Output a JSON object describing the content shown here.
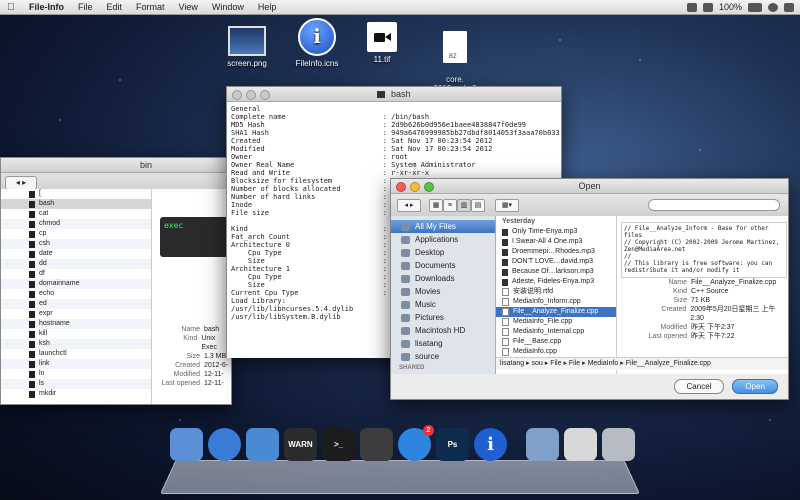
{
  "menubar": {
    "app": "File-Info",
    "items": [
      "File",
      "Edit",
      "Format",
      "View",
      "Window",
      "Help"
    ],
    "battery": "100%",
    "icons": [
      "apple-icon",
      "wifi-icon",
      "volume-icon",
      "battery-icon",
      "search-icon",
      "list-icon"
    ]
  },
  "desktop": {
    "icons": [
      {
        "label": "screen.png",
        "icon": "screenshot-icon"
      },
      {
        "label": "FileInfo.icns",
        "icon": "info-icon"
      },
      {
        "label": "11.tif",
        "icon": "video-icon"
      },
      {
        "label": "core.\n2013…r.bz2",
        "icon": "archive-icon",
        "badge": "BZ"
      }
    ]
  },
  "terminal": {
    "title": "bash",
    "section1": "General",
    "rows": [
      [
        "Complete name",
        ": /bin/bash"
      ],
      [
        "MD5 Hash",
        ": 2d9b626b0d956e1baee4838847f0de99"
      ],
      [
        "SHA1 Hash",
        ": 949a6476999985bb27dbdf8014053f3aaa70b033"
      ],
      [
        "Created",
        ": Sat Nov 17 00:23:54 2012"
      ],
      [
        "Modified",
        ": Sat Nov 17 00:23:54 2012"
      ],
      [
        "Owner",
        ": root"
      ],
      [
        "Owner Real Name",
        ": System Administrator"
      ],
      [
        "Read and Write",
        ": r-xr-xr-x"
      ],
      [
        "Blocksize for filesystem",
        ": 4096"
      ],
      [
        "Number of blocks allocated",
        ": 1264"
      ],
      [
        "Number of hard links",
        ": 1"
      ],
      [
        "Inode",
        ": 9161"
      ],
      [
        "File size",
        ": 1.27 MiB"
      ]
    ],
    "rows2": [
      [
        "Kind",
        ": Unix Exec"
      ],
      [
        "Fat_arch Count",
        ": 2"
      ],
      [
        "Architecture 0",
        ": Intel i38"
      ],
      [
        "    Cpu Type",
        ": Intel i38"
      ],
      [
        "    Size",
        ": 630448"
      ],
      [
        "Architecture 1",
        ": Intel X86"
      ],
      [
        "    Cpu Type",
        ": Intel X86"
      ],
      [
        "    Size",
        ": 699040"
      ],
      [
        "Current Cpu Type",
        ": Intel i38"
      ],
      [
        "Load Library:",
        ""
      ]
    ],
    "libs": [
      "/usr/lib/libncurses.5.4.dylib",
      "/usr/lib/libSystem.B.dylib"
    ]
  },
  "finder": {
    "title": "bin",
    "files": [
      "[",
      "bash",
      "cat",
      "chmod",
      "cp",
      "csh",
      "date",
      "dd",
      "df",
      "domainname",
      "echo",
      "ed",
      "expr",
      "hostname",
      "kill",
      "ksh",
      "launchctl",
      "link",
      "ln",
      "ls",
      "mkdir"
    ],
    "selected": "bash",
    "preview_label": "exec",
    "meta": [
      [
        "Name",
        "bash"
      ],
      [
        "Kind",
        "Unix Exec"
      ],
      [
        "Size",
        "1.3 MB"
      ],
      [
        "Created",
        "2012-6-"
      ],
      [
        "Modified",
        "12-11-"
      ],
      [
        "Last opened",
        "12-11-"
      ]
    ]
  },
  "open_dialog": {
    "title": "Open",
    "sidebar": [
      "All My Files",
      "Applications",
      "Desktop",
      "Documents",
      "Downloads",
      "Movies",
      "Music",
      "Pictures",
      "Macintosh HD",
      "lisatang",
      "source"
    ],
    "shared_label": "SHARED",
    "col_header": "Yesterday",
    "files": [
      "Only Time-Enya.mp3",
      "I Swear-All 4 One.mp3",
      "Droemmepi…Rhodes.mp3",
      "DON'T LOVE…david.mp3",
      "Because Of…larkson.mp3",
      "Adeste, Fideles-Enya.mp3",
      "安装说明.rtfd",
      "MediaInfo_Inform.cpp",
      "File__Analyze_Finalize.cpp",
      "MediaInfo_File.cpp",
      "MediaInfo_Internal.cpp",
      "File__Base.cpp",
      "MediaInfo.cpp",
      "File_Unknown.cpp"
    ],
    "selected": "File__Analyze_Finalize.cpp",
    "preview_text": "// File__Analyze_Inform - Base for other files\n// Copyright (C) 2002-2009 Jerome Martinez, Zen@MediaArea.net\n//\n// This library is free software: you can redistribute it and/or modify it",
    "meta": [
      [
        "Name",
        "File__Analyze_Finalize.cpp"
      ],
      [
        "Kind",
        "C++ Source"
      ],
      [
        "Size",
        "71 KB"
      ],
      [
        "Created",
        "2009年5月20日星期三 上午2:30"
      ],
      [
        "Modified",
        "昨天 下午2:37"
      ],
      [
        "Last opened",
        "昨天 下午7:22"
      ]
    ],
    "path": "lisatang ▸ sou ▸ File ▸ File ▸ MediaInfo ▸ File__Analyze_Finalize.cpp",
    "cancel": "Cancel",
    "open": "Open"
  },
  "dock": {
    "items": [
      {
        "name": "finder-icon",
        "label": "",
        "color": "#5d8fd6"
      },
      {
        "name": "safari-icon",
        "label": "",
        "color": "#3a7bd5"
      },
      {
        "name": "xcode-icon",
        "label": "",
        "color": "#4a8ad0"
      },
      {
        "name": "console-icon",
        "label": "WARN",
        "color": "#2b2b2b"
      },
      {
        "name": "terminal-icon",
        "label": ">_",
        "color": "#1c1c1c"
      },
      {
        "name": "activity-monitor-icon",
        "label": "",
        "color": "#3d3d3d"
      },
      {
        "name": "app-store-icon",
        "label": "",
        "color": "#2e85e0"
      },
      {
        "name": "photoshop-icon",
        "label": "Ps",
        "color": "#0d2b4d"
      },
      {
        "name": "fileinfo-icon",
        "label": "i",
        "color": "#1f5fcf"
      },
      {
        "name": "downloads-stack-icon",
        "label": "",
        "color": "#7fa0c8"
      },
      {
        "name": "documents-stack-icon",
        "label": "",
        "color": "#d8d8d8"
      },
      {
        "name": "trash-icon",
        "label": "",
        "color": "#b7bcc4"
      }
    ],
    "badge": "2"
  }
}
